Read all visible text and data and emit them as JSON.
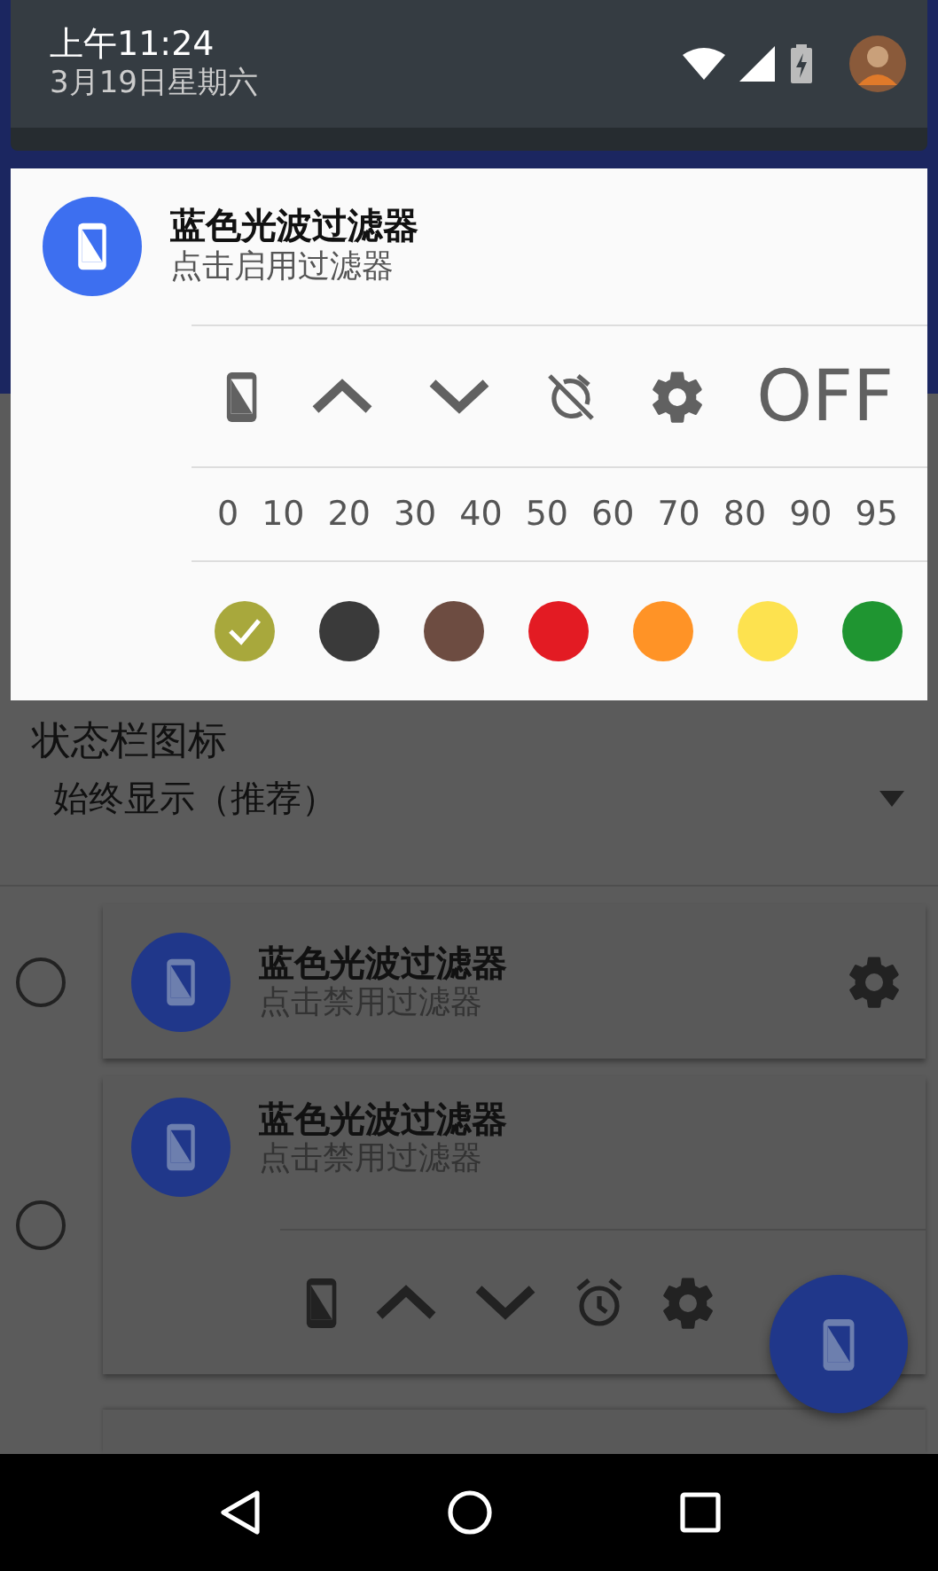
{
  "status_header": {
    "time": "上午11:24",
    "date": "3月19日星期六"
  },
  "notification": {
    "title": "蓝色光波过滤器",
    "subtitle": "点击启用过滤器",
    "actions": [
      {
        "kind": "screen"
      },
      {
        "kind": "up"
      },
      {
        "kind": "down"
      },
      {
        "kind": "alarm_off"
      },
      {
        "kind": "settings"
      },
      {
        "kind": "text",
        "label": "OFF"
      }
    ],
    "levels": [
      "0",
      "10",
      "20",
      "30",
      "40",
      "50",
      "60",
      "70",
      "80",
      "90",
      "95"
    ],
    "colors": [
      {
        "color": "#a8a83c",
        "selected": true
      },
      {
        "color": "#3a3a3a",
        "selected": false
      },
      {
        "color": "#6d4c41",
        "selected": false
      },
      {
        "color": "#e31b23",
        "selected": false
      },
      {
        "color": "#ff9326",
        "selected": false
      },
      {
        "color": "#fde24f",
        "selected": false
      },
      {
        "color": "#1f9531",
        "selected": false
      }
    ]
  },
  "app": {
    "setting": {
      "label": "状态栏图标",
      "value": "始终显示（推荐）"
    },
    "profiles": [
      {
        "title": "蓝色光波过滤器",
        "subtitle": "点击禁用过滤器",
        "selected": false,
        "expanded": false
      },
      {
        "title": "蓝色光波过滤器",
        "subtitle": "点击禁用过滤器",
        "selected": false,
        "expanded": true,
        "actions": [
          {
            "kind": "screen"
          },
          {
            "kind": "up"
          },
          {
            "kind": "down"
          },
          {
            "kind": "alarm"
          },
          {
            "kind": "settings"
          }
        ]
      }
    ]
  }
}
